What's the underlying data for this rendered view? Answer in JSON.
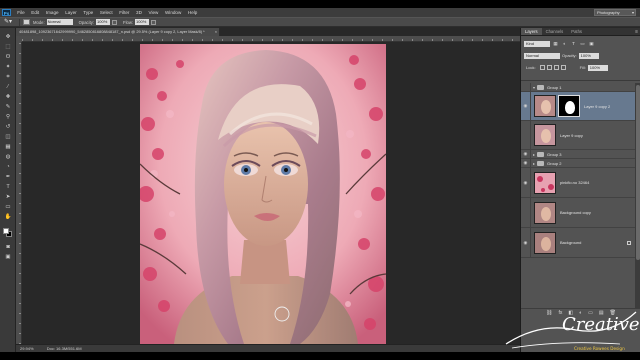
{
  "app": {
    "logo": "Ps"
  },
  "menu": [
    "File",
    "Edit",
    "Image",
    "Layer",
    "Type",
    "Select",
    "Filter",
    "3D",
    "View",
    "Window",
    "Help"
  ],
  "workspace": "Photography",
  "options": {
    "mode_label": "Mode:",
    "mode_value": "Normal",
    "opacity_label": "Opacity:",
    "opacity_value": "100%",
    "flow_label": "Flow:",
    "flow_value": "100%"
  },
  "document": {
    "tab_title": "40481898_10923671642999990_5462850816808848187_n.psd @ 29.5% (Layer 9 copy 2, Layer Mask/8) *",
    "tab_close": "×",
    "zoom": "29.94%",
    "doc_size": "Doc: 16.3M/551.6M"
  },
  "panels": {
    "tabs": [
      "Layers",
      "Channels",
      "Paths"
    ],
    "menu_icon": "≡",
    "kind_label": "Kind",
    "blend_mode": "Normal",
    "opacity_label": "Opacity:",
    "opacity_value": "100%",
    "lock_label": "Lock:",
    "fill_label": "Fill:",
    "fill_value": "100%"
  },
  "layers": [
    {
      "name": "Group 1",
      "type": "group"
    },
    {
      "name": "Layer 9 copy 2",
      "type": "masked",
      "selected": true
    },
    {
      "name": "Layer 9 copy",
      "type": "image"
    },
    {
      "name": "Group 3",
      "type": "group"
    },
    {
      "name": "Group 2",
      "type": "group"
    },
    {
      "name": "pinkflo.no 32464",
      "type": "flower"
    },
    {
      "name": "Background copy",
      "type": "image"
    },
    {
      "name": "Background",
      "type": "image",
      "locked": true
    }
  ],
  "footer_buttons": [
    "⛓",
    "fx",
    "◧",
    "◐",
    "▭",
    "▤",
    "🗑"
  ],
  "watermark": {
    "brand": "Creative",
    "tagline": "Creative Rowees Design"
  },
  "colors": {
    "accent": "#67798f",
    "panel": "#535353",
    "chrome": "#3c3c3c"
  }
}
